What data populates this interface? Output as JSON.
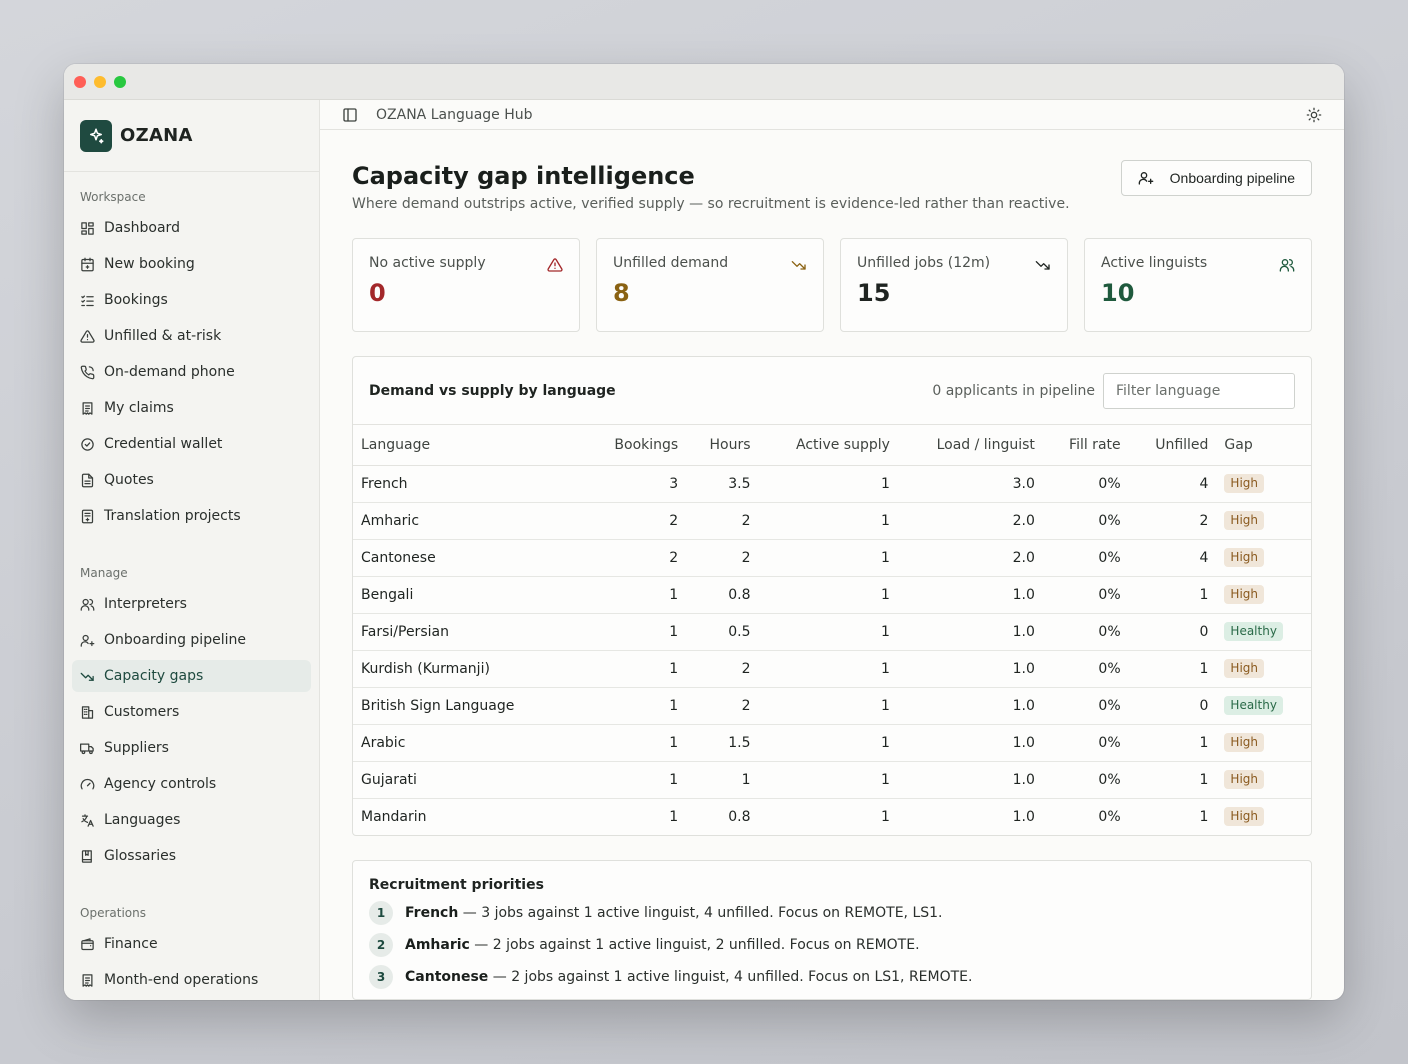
{
  "window": {
    "title": "OZANA Language Hub"
  },
  "brand": {
    "name": "OZANA"
  },
  "sidebar": {
    "sections": [
      {
        "title": "Workspace",
        "items": [
          {
            "label": "Dashboard",
            "icon": "dashboard-icon"
          },
          {
            "label": "New booking",
            "icon": "calendar-plus-icon"
          },
          {
            "label": "Bookings",
            "icon": "list-checks-icon"
          },
          {
            "label": "Unfilled & at-risk",
            "icon": "warning-icon"
          },
          {
            "label": "On-demand phone",
            "icon": "phone-icon"
          },
          {
            "label": "My claims",
            "icon": "receipt-icon"
          },
          {
            "label": "Credential wallet",
            "icon": "badge-check-icon"
          },
          {
            "label": "Quotes",
            "icon": "file-icon"
          },
          {
            "label": "Translation projects",
            "icon": "file-text-icon"
          }
        ]
      },
      {
        "title": "Manage",
        "items": [
          {
            "label": "Interpreters",
            "icon": "users-icon"
          },
          {
            "label": "Onboarding pipeline",
            "icon": "user-plus-icon"
          },
          {
            "label": "Capacity gaps",
            "icon": "trending-down-icon",
            "active": true
          },
          {
            "label": "Customers",
            "icon": "building-icon"
          },
          {
            "label": "Suppliers",
            "icon": "truck-icon"
          },
          {
            "label": "Agency controls",
            "icon": "gauge-icon"
          },
          {
            "label": "Languages",
            "icon": "languages-icon"
          },
          {
            "label": "Glossaries",
            "icon": "book-icon"
          }
        ]
      },
      {
        "title": "Operations",
        "items": [
          {
            "label": "Finance",
            "icon": "wallet-icon"
          },
          {
            "label": "Month-end operations",
            "icon": "receipt-icon"
          }
        ]
      }
    ]
  },
  "page": {
    "title": "Capacity gap intelligence",
    "subtitle": "Where demand outstrips active, verified supply — so recruitment is evidence-led rather than reactive.",
    "action_label": "Onboarding pipeline"
  },
  "stats": [
    {
      "label": "No active supply",
      "value": "0",
      "icon": "alert-triangle-icon",
      "color": "#a3282a"
    },
    {
      "label": "Unfilled demand",
      "value": "8",
      "icon": "trending-down-icon",
      "color": "#8a6212"
    },
    {
      "label": "Unfilled jobs (12m)",
      "value": "15",
      "icon": "trending-down-icon",
      "color": "#1f2421"
    },
    {
      "label": "Active linguists",
      "value": "10",
      "icon": "users-icon",
      "color": "#1f5a3d"
    }
  ],
  "demand_panel": {
    "title": "Demand vs supply by language",
    "meta": "0 applicants in pipeline",
    "filter_placeholder": "Filter language",
    "columns": [
      "Language",
      "Bookings",
      "Hours",
      "Active supply",
      "Load / linguist",
      "Fill rate",
      "Unfilled",
      "Gap"
    ],
    "rows": [
      {
        "language": "French",
        "bookings": "3",
        "hours": "3.5",
        "supply": "1",
        "load": "3.0",
        "fill": "0%",
        "unfilled": "4",
        "gap": "High"
      },
      {
        "language": "Amharic",
        "bookings": "2",
        "hours": "2",
        "supply": "1",
        "load": "2.0",
        "fill": "0%",
        "unfilled": "2",
        "gap": "High"
      },
      {
        "language": "Cantonese",
        "bookings": "2",
        "hours": "2",
        "supply": "1",
        "load": "2.0",
        "fill": "0%",
        "unfilled": "4",
        "gap": "High"
      },
      {
        "language": "Bengali",
        "bookings": "1",
        "hours": "0.8",
        "supply": "1",
        "load": "1.0",
        "fill": "0%",
        "unfilled": "1",
        "gap": "High"
      },
      {
        "language": "Farsi/Persian",
        "bookings": "1",
        "hours": "0.5",
        "supply": "1",
        "load": "1.0",
        "fill": "0%",
        "unfilled": "0",
        "gap": "Healthy"
      },
      {
        "language": "Kurdish (Kurmanji)",
        "bookings": "1",
        "hours": "2",
        "supply": "1",
        "load": "1.0",
        "fill": "0%",
        "unfilled": "1",
        "gap": "High"
      },
      {
        "language": "British Sign Language",
        "bookings": "1",
        "hours": "2",
        "supply": "1",
        "load": "1.0",
        "fill": "0%",
        "unfilled": "0",
        "gap": "Healthy"
      },
      {
        "language": "Arabic",
        "bookings": "1",
        "hours": "1.5",
        "supply": "1",
        "load": "1.0",
        "fill": "0%",
        "unfilled": "1",
        "gap": "High"
      },
      {
        "language": "Gujarati",
        "bookings": "1",
        "hours": "1",
        "supply": "1",
        "load": "1.0",
        "fill": "0%",
        "unfilled": "1",
        "gap": "High"
      },
      {
        "language": "Mandarin",
        "bookings": "1",
        "hours": "0.8",
        "supply": "1",
        "load": "1.0",
        "fill": "0%",
        "unfilled": "1",
        "gap": "High"
      }
    ]
  },
  "priorities": {
    "title": "Recruitment priorities",
    "items": [
      {
        "num": "1",
        "language": "French",
        "text": " — 3 jobs against 1 active linguist, 4 unfilled. Focus on REMOTE, LS1."
      },
      {
        "num": "2",
        "language": "Amharic",
        "text": " — 2 jobs against 1 active linguist, 2 unfilled. Focus on REMOTE."
      },
      {
        "num": "3",
        "language": "Cantonese",
        "text": " — 2 jobs against 1 active linguist, 4 unfilled. Focus on LS1, REMOTE."
      }
    ]
  }
}
